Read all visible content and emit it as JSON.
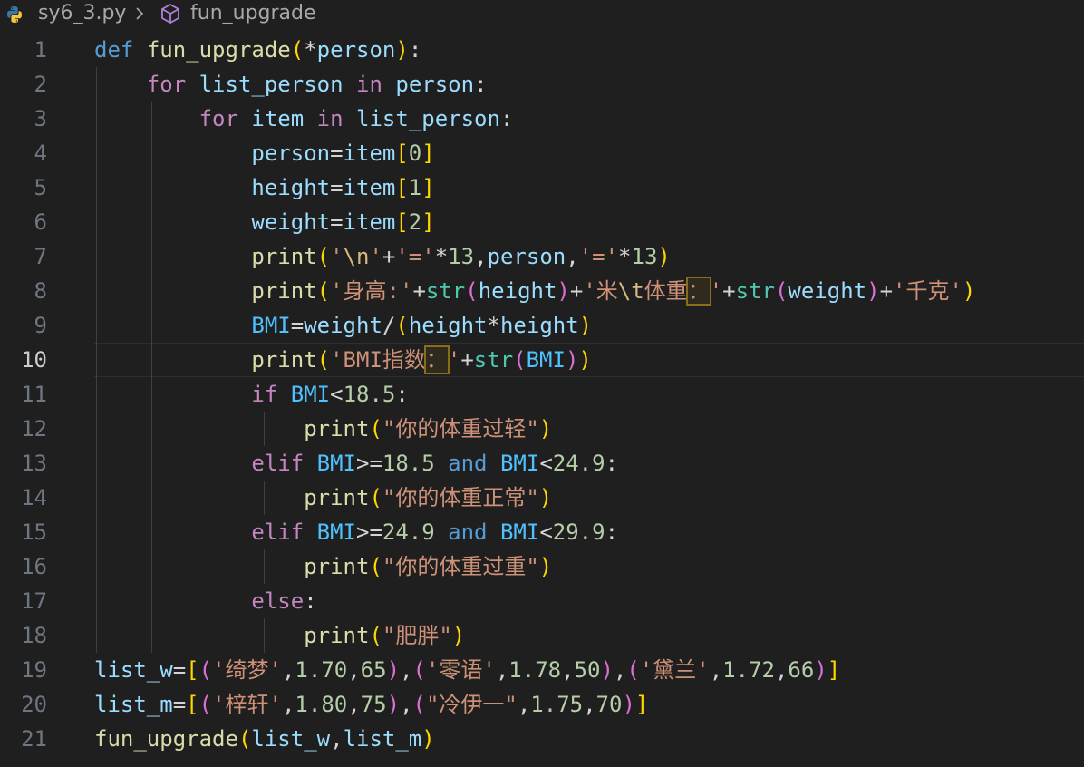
{
  "breadcrumb": {
    "file": "sy6_3.py",
    "symbol": "fun_upgrade",
    "file_icon": "python-icon",
    "symbol_icon": "cube-method-icon"
  },
  "editor": {
    "current_line": 10,
    "lines": [
      {
        "n": "1",
        "tokens": [
          [
            "kw",
            "def"
          ],
          [
            "op",
            " "
          ],
          [
            "fn",
            "fun_upgrade"
          ],
          [
            "b1",
            "("
          ],
          [
            "op",
            "*"
          ],
          [
            "var",
            "person"
          ],
          [
            "b1",
            ")"
          ],
          [
            "op",
            ":"
          ]
        ]
      },
      {
        "n": "2",
        "tokens": [
          [
            "op",
            "    "
          ],
          [
            "ctl",
            "for"
          ],
          [
            "op",
            " "
          ],
          [
            "var",
            "list_person"
          ],
          [
            "op",
            " "
          ],
          [
            "ctl",
            "in"
          ],
          [
            "op",
            " "
          ],
          [
            "var",
            "person"
          ],
          [
            "op",
            ":"
          ]
        ]
      },
      {
        "n": "3",
        "tokens": [
          [
            "op",
            "        "
          ],
          [
            "ctl",
            "for"
          ],
          [
            "op",
            " "
          ],
          [
            "var",
            "item"
          ],
          [
            "op",
            " "
          ],
          [
            "ctl",
            "in"
          ],
          [
            "op",
            " "
          ],
          [
            "var",
            "list_person"
          ],
          [
            "op",
            ":"
          ]
        ]
      },
      {
        "n": "4",
        "tokens": [
          [
            "op",
            "            "
          ],
          [
            "var",
            "person"
          ],
          [
            "op",
            "="
          ],
          [
            "var",
            "item"
          ],
          [
            "b1",
            "["
          ],
          [
            "num",
            "0"
          ],
          [
            "b1",
            "]"
          ]
        ]
      },
      {
        "n": "5",
        "tokens": [
          [
            "op",
            "            "
          ],
          [
            "var",
            "height"
          ],
          [
            "op",
            "="
          ],
          [
            "var",
            "item"
          ],
          [
            "b1",
            "["
          ],
          [
            "num",
            "1"
          ],
          [
            "b1",
            "]"
          ]
        ]
      },
      {
        "n": "6",
        "tokens": [
          [
            "op",
            "            "
          ],
          [
            "var",
            "weight"
          ],
          [
            "op",
            "="
          ],
          [
            "var",
            "item"
          ],
          [
            "b1",
            "["
          ],
          [
            "num",
            "2"
          ],
          [
            "b1",
            "]"
          ]
        ]
      },
      {
        "n": "7",
        "tokens": [
          [
            "op",
            "            "
          ],
          [
            "fn",
            "print"
          ],
          [
            "b1",
            "("
          ],
          [
            "str",
            "'"
          ],
          [
            "esc",
            "\\n"
          ],
          [
            "str",
            "'"
          ],
          [
            "op",
            "+"
          ],
          [
            "str",
            "'='"
          ],
          [
            "op",
            "*"
          ],
          [
            "num",
            "13"
          ],
          [
            "op",
            ","
          ],
          [
            "var",
            "person"
          ],
          [
            "op",
            ","
          ],
          [
            "str",
            "'='"
          ],
          [
            "op",
            "*"
          ],
          [
            "num",
            "13"
          ],
          [
            "b1",
            ")"
          ]
        ]
      },
      {
        "n": "8",
        "tokens": [
          [
            "op",
            "            "
          ],
          [
            "fn",
            "print"
          ],
          [
            "b1",
            "("
          ],
          [
            "str",
            "'身高:'"
          ],
          [
            "op",
            "+"
          ],
          [
            "bi",
            "str"
          ],
          [
            "b2",
            "("
          ],
          [
            "var",
            "height"
          ],
          [
            "b2",
            ")"
          ],
          [
            "op",
            "+"
          ],
          [
            "str",
            "'米"
          ],
          [
            "esc",
            "\\t"
          ],
          [
            "str",
            "体重"
          ],
          [
            "str hl",
            "："
          ],
          [
            "str",
            "'"
          ],
          [
            "op",
            "+"
          ],
          [
            "bi",
            "str"
          ],
          [
            "b2",
            "("
          ],
          [
            "var",
            "weight"
          ],
          [
            "b2",
            ")"
          ],
          [
            "op",
            "+"
          ],
          [
            "str",
            "'千克'"
          ],
          [
            "b1",
            ")"
          ]
        ]
      },
      {
        "n": "9",
        "tokens": [
          [
            "op",
            "            "
          ],
          [
            "cst",
            "BMI"
          ],
          [
            "op",
            "="
          ],
          [
            "var",
            "weight"
          ],
          [
            "op",
            "/"
          ],
          [
            "b1",
            "("
          ],
          [
            "var",
            "height"
          ],
          [
            "op",
            "*"
          ],
          [
            "var",
            "height"
          ],
          [
            "b1",
            ")"
          ]
        ]
      },
      {
        "n": "10",
        "tokens": [
          [
            "op",
            "            "
          ],
          [
            "fn",
            "print"
          ],
          [
            "b1",
            "("
          ],
          [
            "str",
            "'BMI指数"
          ],
          [
            "str hl",
            "："
          ],
          [
            "str",
            "'"
          ],
          [
            "op",
            "+"
          ],
          [
            "bi",
            "str"
          ],
          [
            "b2",
            "("
          ],
          [
            "cst",
            "BMI"
          ],
          [
            "b2",
            ")"
          ],
          [
            "b1",
            ")"
          ]
        ]
      },
      {
        "n": "11",
        "tokens": [
          [
            "op",
            "            "
          ],
          [
            "ctl",
            "if"
          ],
          [
            "op",
            " "
          ],
          [
            "cst",
            "BMI"
          ],
          [
            "op",
            "<"
          ],
          [
            "num",
            "18.5"
          ],
          [
            "op",
            ":"
          ]
        ]
      },
      {
        "n": "12",
        "tokens": [
          [
            "op",
            "                "
          ],
          [
            "fn",
            "print"
          ],
          [
            "b1",
            "("
          ],
          [
            "str",
            "\"你的体重过轻\""
          ],
          [
            "b1",
            ")"
          ]
        ]
      },
      {
        "n": "13",
        "tokens": [
          [
            "op",
            "            "
          ],
          [
            "ctl",
            "elif"
          ],
          [
            "op",
            " "
          ],
          [
            "cst",
            "BMI"
          ],
          [
            "op",
            ">="
          ],
          [
            "num",
            "18.5"
          ],
          [
            "op",
            " "
          ],
          [
            "kw",
            "and"
          ],
          [
            "op",
            " "
          ],
          [
            "cst",
            "BMI"
          ],
          [
            "op",
            "<"
          ],
          [
            "num",
            "24.9"
          ],
          [
            "op",
            ":"
          ]
        ]
      },
      {
        "n": "14",
        "tokens": [
          [
            "op",
            "                "
          ],
          [
            "fn",
            "print"
          ],
          [
            "b1",
            "("
          ],
          [
            "str",
            "\"你的体重正常\""
          ],
          [
            "b1",
            ")"
          ]
        ]
      },
      {
        "n": "15",
        "tokens": [
          [
            "op",
            "            "
          ],
          [
            "ctl",
            "elif"
          ],
          [
            "op",
            " "
          ],
          [
            "cst",
            "BMI"
          ],
          [
            "op",
            ">="
          ],
          [
            "num",
            "24.9"
          ],
          [
            "op",
            " "
          ],
          [
            "kw",
            "and"
          ],
          [
            "op",
            " "
          ],
          [
            "cst",
            "BMI"
          ],
          [
            "op",
            "<"
          ],
          [
            "num",
            "29.9"
          ],
          [
            "op",
            ":"
          ]
        ]
      },
      {
        "n": "16",
        "tokens": [
          [
            "op",
            "                "
          ],
          [
            "fn",
            "print"
          ],
          [
            "b1",
            "("
          ],
          [
            "str",
            "\"你的体重过重\""
          ],
          [
            "b1",
            ")"
          ]
        ]
      },
      {
        "n": "17",
        "tokens": [
          [
            "op",
            "            "
          ],
          [
            "ctl",
            "else"
          ],
          [
            "op",
            ":"
          ]
        ]
      },
      {
        "n": "18",
        "tokens": [
          [
            "op",
            "                "
          ],
          [
            "fn",
            "print"
          ],
          [
            "b1",
            "("
          ],
          [
            "str",
            "\"肥胖\""
          ],
          [
            "b1",
            ")"
          ]
        ]
      },
      {
        "n": "19",
        "tokens": [
          [
            "var",
            "list_w"
          ],
          [
            "op",
            "="
          ],
          [
            "b1",
            "["
          ],
          [
            "b2",
            "("
          ],
          [
            "str",
            "'绮梦'"
          ],
          [
            "op",
            ","
          ],
          [
            "num",
            "1.70"
          ],
          [
            "op",
            ","
          ],
          [
            "num",
            "65"
          ],
          [
            "b2",
            ")"
          ],
          [
            "op",
            ","
          ],
          [
            "b2",
            "("
          ],
          [
            "str",
            "'零语'"
          ],
          [
            "op",
            ","
          ],
          [
            "num",
            "1.78"
          ],
          [
            "op",
            ","
          ],
          [
            "num",
            "50"
          ],
          [
            "b2",
            ")"
          ],
          [
            "op",
            ","
          ],
          [
            "b2",
            "("
          ],
          [
            "str",
            "'黛兰'"
          ],
          [
            "op",
            ","
          ],
          [
            "num",
            "1.72"
          ],
          [
            "op",
            ","
          ],
          [
            "num",
            "66"
          ],
          [
            "b2",
            ")"
          ],
          [
            "b1",
            "]"
          ]
        ]
      },
      {
        "n": "20",
        "tokens": [
          [
            "var",
            "list_m"
          ],
          [
            "op",
            "="
          ],
          [
            "b1",
            "["
          ],
          [
            "b2",
            "("
          ],
          [
            "str",
            "'梓轩'"
          ],
          [
            "op",
            ","
          ],
          [
            "num",
            "1.80"
          ],
          [
            "op",
            ","
          ],
          [
            "num",
            "75"
          ],
          [
            "b2",
            ")"
          ],
          [
            "op",
            ","
          ],
          [
            "b2",
            "("
          ],
          [
            "str",
            "\"冷伊一\""
          ],
          [
            "op",
            ","
          ],
          [
            "num",
            "1.75"
          ],
          [
            "op",
            ","
          ],
          [
            "num",
            "70"
          ],
          [
            "b2",
            ")"
          ],
          [
            "b1",
            "]"
          ]
        ]
      },
      {
        "n": "21",
        "tokens": [
          [
            "fn",
            "fun_upgrade"
          ],
          [
            "b1",
            "("
          ],
          [
            "var",
            "list_w"
          ],
          [
            "op",
            ","
          ],
          [
            "var",
            "list_m"
          ],
          [
            "b1",
            ")"
          ]
        ]
      }
    ]
  }
}
